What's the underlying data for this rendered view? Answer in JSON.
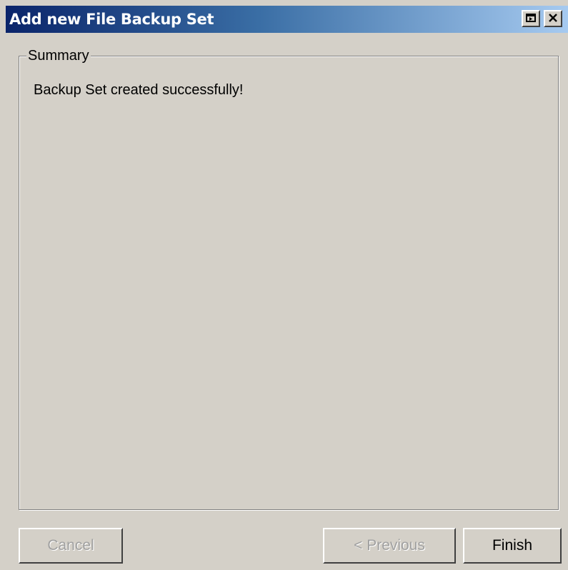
{
  "window": {
    "title": "Add new File Backup Set",
    "restore_glyph": "⧉",
    "close_glyph": "✕"
  },
  "summary": {
    "legend": "Summary",
    "message": "Backup Set created successfully!"
  },
  "buttons": {
    "cancel": "Cancel",
    "previous": "< Previous",
    "finish": "Finish"
  },
  "colors": {
    "titlebar_start": "#0a246a",
    "titlebar_end": "#a6caf0",
    "window_bg": "#d4d0c8"
  }
}
